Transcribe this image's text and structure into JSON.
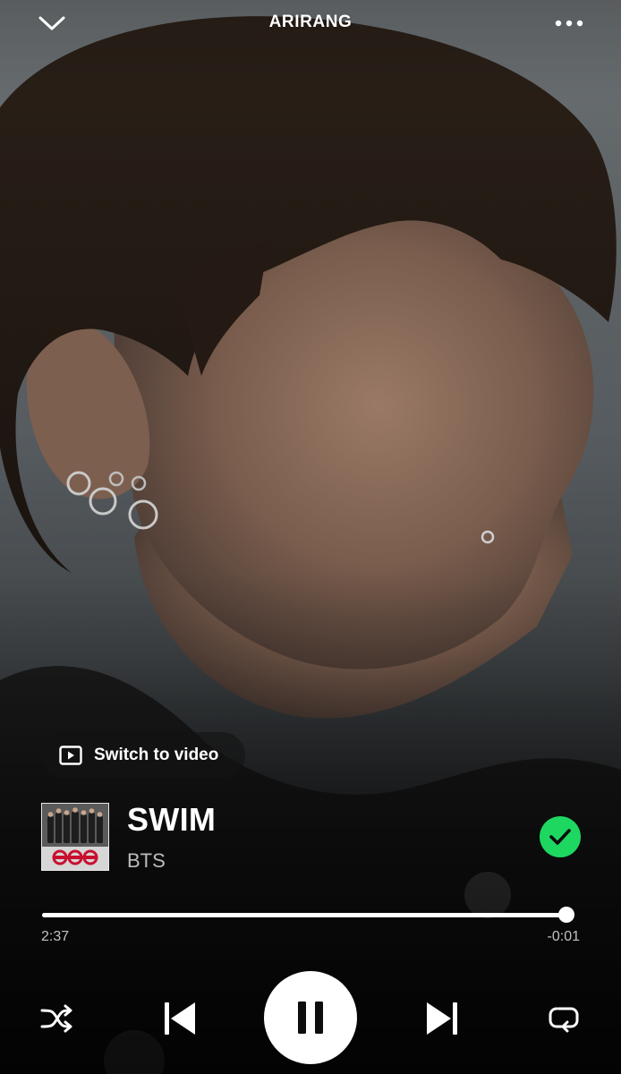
{
  "header": {
    "context_title": "ARIRANG",
    "collapse_icon": "chevron-down-icon",
    "more_icon": "more-options-icon"
  },
  "video_toggle": {
    "label": "Switch to video",
    "icon": "video-play-icon"
  },
  "track": {
    "title": "SWIM",
    "artist": "BTS",
    "saved": true,
    "saved_icon": "checkmark-icon"
  },
  "playback": {
    "elapsed": "2:37",
    "remaining": "-0:01",
    "progress_fraction": 0.994,
    "is_playing": true
  },
  "controls": {
    "shuffle_icon": "shuffle-icon",
    "previous_icon": "skip-previous-icon",
    "play_pause_icon": "pause-icon",
    "next_icon": "skip-next-icon",
    "repeat_icon": "repeat-icon"
  },
  "colors": {
    "accent_green": "#1ed760",
    "text_primary": "#ffffff",
    "text_secondary": "#b8b8b8"
  }
}
